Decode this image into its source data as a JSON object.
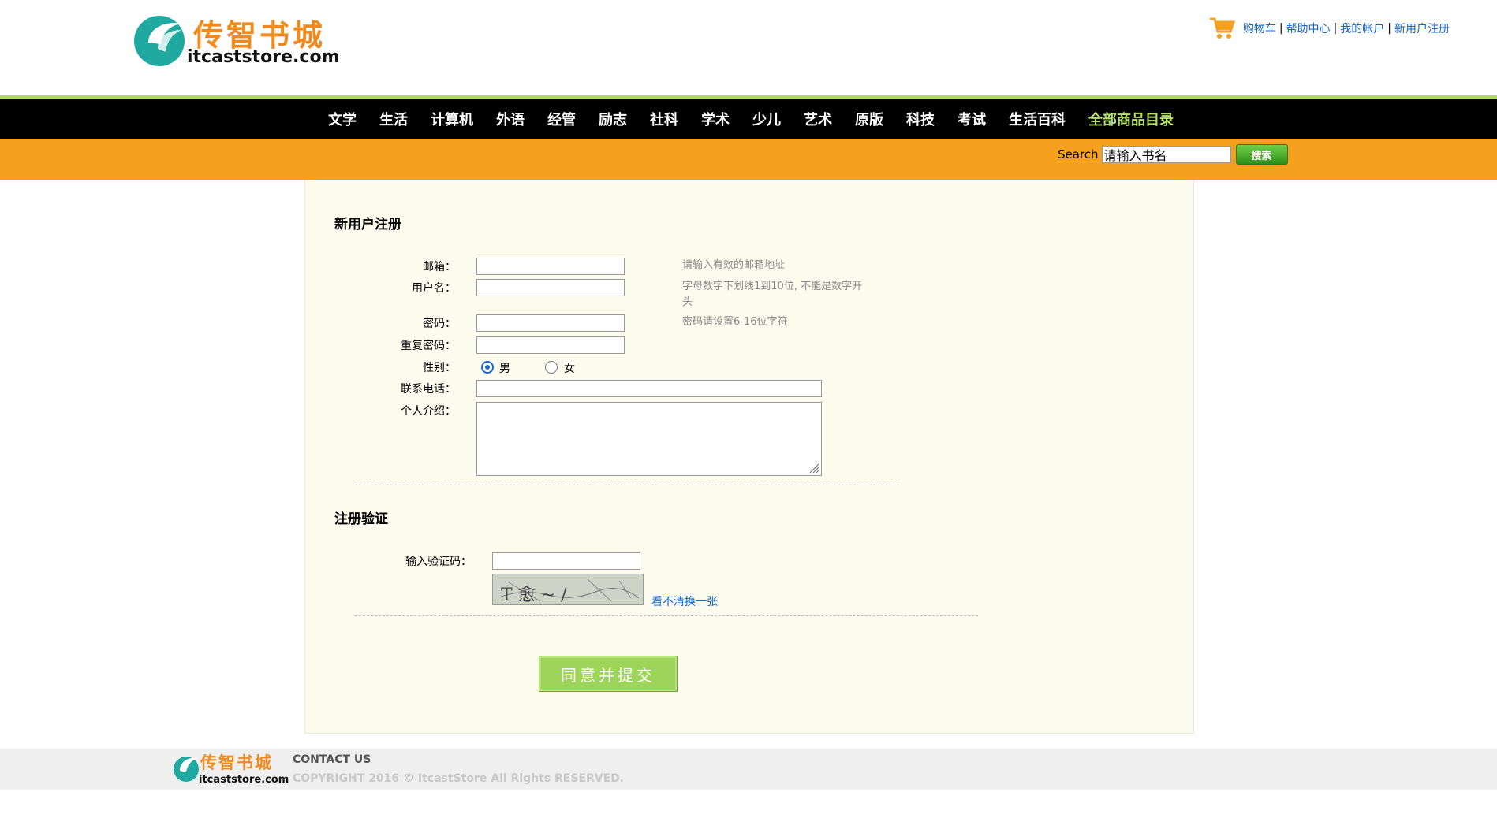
{
  "brand": {
    "logo_cn": "传智书城",
    "logo_en": "itcaststore.com"
  },
  "toplinks": {
    "cart": "购物车",
    "help": "帮助中心",
    "account": "我的帐户",
    "register": "新用户注册",
    "separator": "|"
  },
  "nav": {
    "items": [
      "文学",
      "生活",
      "计算机",
      "外语",
      "经管",
      "励志",
      "社科",
      "学术",
      "少儿",
      "艺术",
      "原版",
      "科技",
      "考试",
      "生活百科"
    ],
    "all": "全部商品目录"
  },
  "search": {
    "label": "Search",
    "value": "请输入书名",
    "button": "搜索"
  },
  "form": {
    "title": "新用户注册",
    "email": {
      "label": "邮箱：",
      "hint": "请输入有效的邮箱地址"
    },
    "username": {
      "label": "用户名：",
      "hint_line1": "字母数字下划线1到10位, 不能是数字开",
      "hint_line2": "头"
    },
    "password": {
      "label": "密码：",
      "hint": "密码请设置6-16位字符"
    },
    "repassword": {
      "label": "重复密码："
    },
    "gender": {
      "label": "性别：",
      "male": "男",
      "female": "女",
      "selected": "男"
    },
    "phone": {
      "label": "联系电话："
    },
    "intro": {
      "label": "个人介绍："
    }
  },
  "verify": {
    "title": "注册验证",
    "label": "输入验证码：",
    "refresh": "看不清换一张",
    "captcha_text": "T 愈 ~ /"
  },
  "submit": "同意并提交",
  "footer": {
    "contact": "CONTACT US",
    "copyright": "COPYRIGHT 2016 © ItcastStore All Rights RESERVED."
  },
  "colors": {
    "nav_bg": "#000000",
    "nav_accent": "#b5e06a",
    "orange_bar": "#f5a01e",
    "link": "#1565c0",
    "submit": "#9dd45a"
  }
}
